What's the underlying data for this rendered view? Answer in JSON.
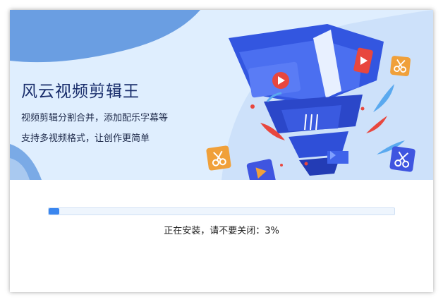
{
  "app": {
    "title": "风云视频剪辑王",
    "tagline_1": "视频剪辑分割合并，添加配乐字幕等",
    "tagline_2": "支持多视频格式，让创作更简单"
  },
  "install": {
    "status_text": "正在安装，请不要关闭：3%",
    "progress_fraction": 0.03
  },
  "colors": {
    "banner_bg": "#dfeefe",
    "accent": "#3a86ef",
    "funnel_blue": "#2f4fd8",
    "orange_badge": "#f0a03a",
    "play_red": "#e8473e"
  },
  "icons": [
    "scissors-icon",
    "play-icon"
  ]
}
